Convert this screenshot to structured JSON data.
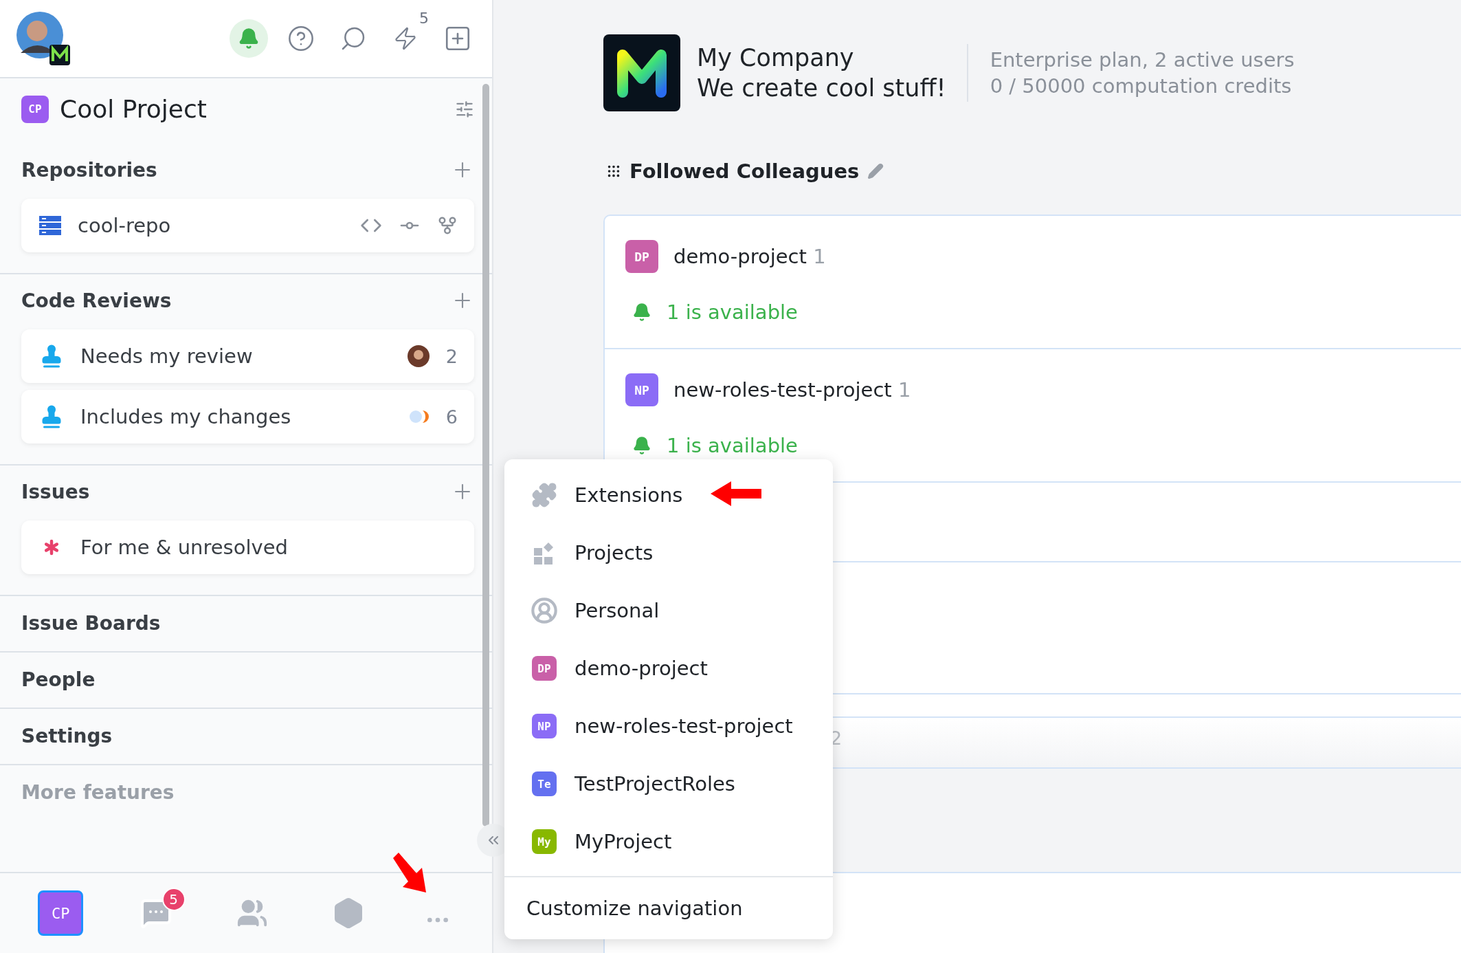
{
  "top_bar": {
    "lightning_count": "5",
    "notifications_on": true
  },
  "project": {
    "badge": "CP",
    "title": "Cool Project",
    "color": "#9b5cf0"
  },
  "sections": [
    {
      "title": "Repositories",
      "items": [
        {
          "kind": "repo",
          "label": "cool-repo"
        }
      ]
    },
    {
      "title": "Code Reviews",
      "items": [
        {
          "kind": "assigned",
          "label": "Needs my review",
          "count": "2"
        },
        {
          "kind": "authored",
          "label": "Includes my changes",
          "count": "6"
        }
      ]
    },
    {
      "title": "Issues",
      "items": [
        {
          "kind": "issue",
          "label": "For me & unresolved"
        }
      ]
    }
  ],
  "nav_links": [
    {
      "label": "Issue Boards",
      "dimmed": false
    },
    {
      "label": "People",
      "dimmed": false
    },
    {
      "label": "Settings",
      "dimmed": false
    },
    {
      "label": "More features",
      "dimmed": true
    }
  ],
  "bottom_bar": [
    {
      "kind": "project",
      "badge": "CP",
      "color": "#9b5cf0",
      "selected": true
    },
    {
      "kind": "chat",
      "count": "5",
      "selected": false
    },
    {
      "kind": "people",
      "selected": false
    },
    {
      "kind": "settings",
      "selected": false
    },
    {
      "kind": "more",
      "selected": false
    }
  ],
  "company": {
    "name": "My Company",
    "tagline": "We create cool stuff!",
    "plan": "Enterprise plan, 2 active users",
    "credits": "0 / 50000 computation credits"
  },
  "followed": {
    "title": "Followed Colleagues",
    "rows": [
      {
        "badge": "DP",
        "color": "#c960a8",
        "name": "demo-project",
        "count": "1",
        "status": "1 is available"
      },
      {
        "badge": "NP",
        "color": "#8b6cf6",
        "name": "new-roles-test-project",
        "count": "1",
        "status": "1 is available"
      }
    ],
    "hidden_row_tail": "2"
  },
  "menu": {
    "items": [
      {
        "kind": "extensions",
        "label": "Extensions"
      },
      {
        "kind": "projects",
        "label": "Projects"
      },
      {
        "kind": "personal",
        "label": "Personal"
      },
      {
        "kind": "project",
        "badge": "DP",
        "color": "#c960a8",
        "label": "demo-project"
      },
      {
        "kind": "project",
        "badge": "NP",
        "color": "#8b6cf6",
        "label": "new-roles-test-project"
      },
      {
        "kind": "project",
        "badge": "Te",
        "color": "#6470f0",
        "label": "TestProjectRoles"
      },
      {
        "kind": "project",
        "badge": "My",
        "color": "#88b800",
        "label": "MyProject"
      }
    ],
    "footer": "Customize navigation"
  }
}
